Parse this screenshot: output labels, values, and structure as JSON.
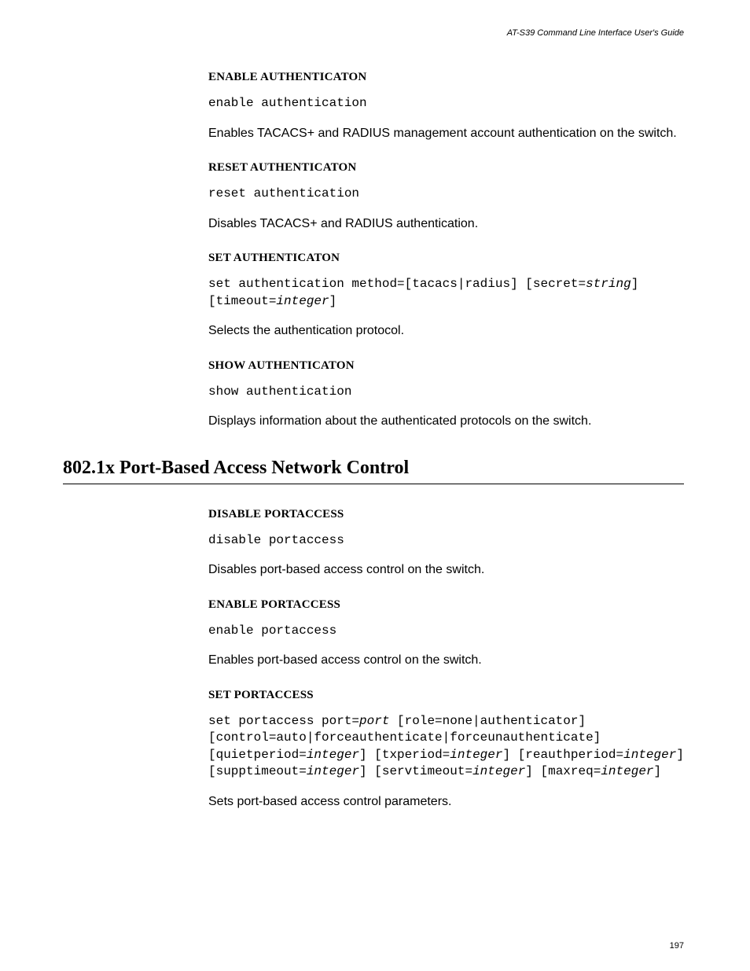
{
  "header": "AT-S39 Command Line Interface User's Guide",
  "page_number": "197",
  "sections": {
    "enable_auth": {
      "heading": "ENABLE AUTHENTICATON",
      "code": "enable authentication",
      "desc": "Enables TACACS+ and RADIUS management account authentication on the switch."
    },
    "reset_auth": {
      "heading": "RESET AUTHENTICATON",
      "code": "reset authentication",
      "desc": "Disables TACACS+ and RADIUS authentication."
    },
    "set_auth": {
      "heading": "SET AUTHENTICATON",
      "code_pre1": "set authentication method=[tacacs|radius] [secret=",
      "code_ital1": "string",
      "code_mid1": "] [timeout=",
      "code_ital2": "integer",
      "code_post1": "]",
      "desc": "Selects the authentication protocol."
    },
    "show_auth": {
      "heading": "SHOW AUTHENTICATON",
      "code": "show authentication",
      "desc": "Displays information about the authenticated protocols on the switch."
    },
    "main_section": "802.1x Port-Based Access Network Control",
    "disable_port": {
      "heading": "DISABLE PORTACCESS",
      "code": "disable portaccess",
      "desc": "Disables port-based access control on the switch."
    },
    "enable_port": {
      "heading": "ENABLE PORTACCESS",
      "code": "enable portaccess",
      "desc": "Enables port-based access control on the switch."
    },
    "set_port": {
      "heading": "SET PORTACCESS",
      "c1a": "set portaccess port=",
      "c1b": "port",
      "c2": " [role=none|authenticator] [control=auto|forceauthenticate|forceunauthenticate] [quietperiod=",
      "c3": "integer",
      "c4": "] [txperiod=",
      "c5": "integer",
      "c6": "] [reauthperiod=",
      "c7": "integer",
      "c8": "] [supptimeout=",
      "c9": "integer",
      "c10": "] [servtimeout=",
      "c11": "integer",
      "c12": "] [maxreq=",
      "c13": "integer",
      "c14": "]",
      "desc": "Sets port-based access control parameters."
    }
  }
}
